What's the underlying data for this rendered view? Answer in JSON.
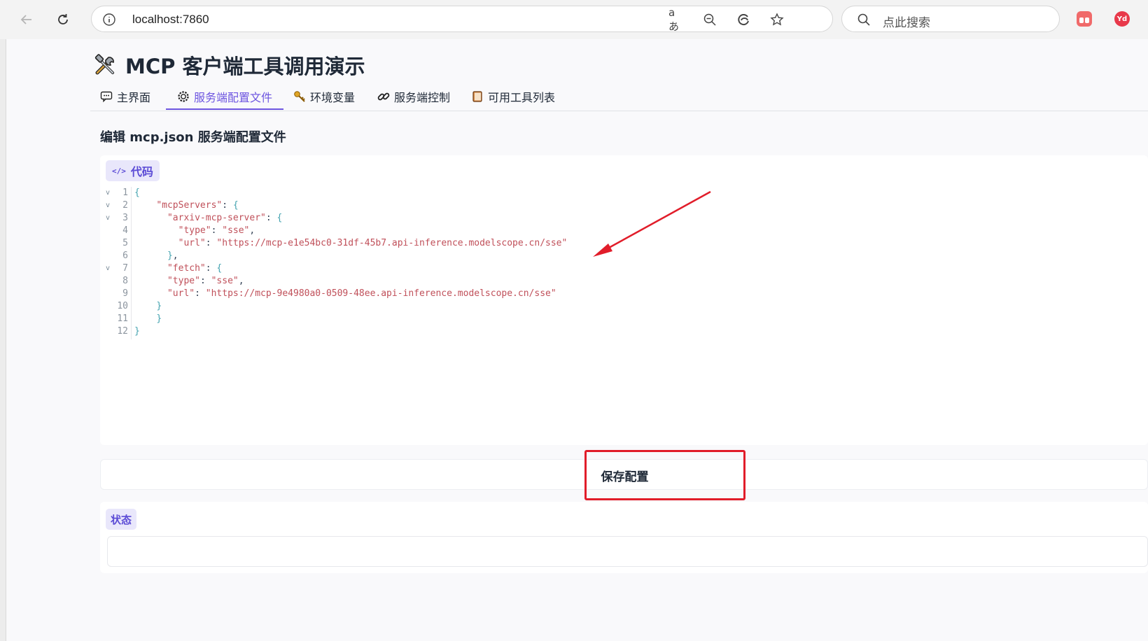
{
  "browser": {
    "address": "localhost:7860",
    "search_placeholder": "点此搜索",
    "extension_profile_label": "Yd"
  },
  "app": {
    "title_icon": "tools-icon",
    "title": "MCP 客户端工具调用演示"
  },
  "tabs": [
    {
      "icon": "speech-bubble-icon",
      "label": "主界面",
      "active": false
    },
    {
      "icon": "gear-icon",
      "label": "服务端配置文件",
      "active": true
    },
    {
      "icon": "key-icon",
      "label": "环境变量",
      "active": false
    },
    {
      "icon": "link-icon",
      "label": "服务端控制",
      "active": false
    },
    {
      "icon": "book-icon",
      "label": "可用工具列表",
      "active": false
    }
  ],
  "section_heading": "编辑 mcp.json 服务端配置文件",
  "code_panel": {
    "label": "代码",
    "lines": [
      {
        "n": "1",
        "fold": true
      },
      {
        "n": "2",
        "fold": true
      },
      {
        "n": "3",
        "fold": true
      },
      {
        "n": "4",
        "fold": false
      },
      {
        "n": "5",
        "fold": false
      },
      {
        "n": "6",
        "fold": false
      },
      {
        "n": "7",
        "fold": true
      },
      {
        "n": "8",
        "fold": false
      },
      {
        "n": "9",
        "fold": false
      },
      {
        "n": "10",
        "fold": false
      },
      {
        "n": "11",
        "fold": false
      },
      {
        "n": "12",
        "fold": false
      }
    ],
    "code": {
      "l1": "{",
      "l2_key": "\"mcpServers\"",
      "l3_key": "\"arxiv-mcp-server\"",
      "l4_key": "\"type\"",
      "l4_val": "\"sse\"",
      "l5_key": "\"url\"",
      "l5_val": "\"https://mcp-e1e54bc0-31df-45b7.api-inference.modelscope.cn/sse\"",
      "l7_key": "\"fetch\"",
      "l8_key": "\"type\"",
      "l8_val": "\"sse\"",
      "l9_key": "\"url\"",
      "l9_val": "\"https://mcp-9e4980a0-0509-48ee.api-inference.modelscope.cn/sse\""
    }
  },
  "save_button_label": "保存配置",
  "status_panel": {
    "label": "状态",
    "value": ""
  },
  "colors": {
    "accent": "#6d55e0",
    "annotation_red": "#e11d2a",
    "code_string": "#c0505a"
  }
}
